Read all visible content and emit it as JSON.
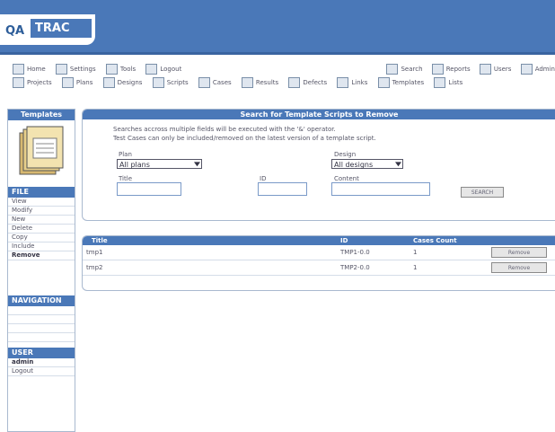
{
  "app": {
    "logo_qa": "QA",
    "logo_trac": "TRAC"
  },
  "toolbar_row1": [
    {
      "label": "Home",
      "icon": "home-icon"
    },
    {
      "label": "Settings",
      "icon": "settings-icon"
    },
    {
      "label": "Tools",
      "icon": "tools-icon"
    },
    {
      "label": "Logout",
      "icon": "logout-icon"
    }
  ],
  "toolbar_row1_right": [
    {
      "label": "Search",
      "icon": "search-icon"
    },
    {
      "label": "Reports",
      "icon": "reports-icon"
    },
    {
      "label": "Users",
      "icon": "users-icon"
    },
    {
      "label": "Admin",
      "icon": "admin-icon"
    }
  ],
  "toolbar_row2": [
    {
      "label": "Projects",
      "icon": "projects-icon"
    },
    {
      "label": "Plans",
      "icon": "plans-icon"
    },
    {
      "label": "Designs",
      "icon": "designs-icon"
    },
    {
      "label": "Scripts",
      "icon": "scripts-icon"
    },
    {
      "label": "Cases",
      "icon": "cases-icon"
    },
    {
      "label": "Results",
      "icon": "results-icon"
    },
    {
      "label": "Defects",
      "icon": "defects-icon"
    },
    {
      "label": "Links",
      "icon": "links-icon"
    },
    {
      "label": "Templates",
      "icon": "templates-icon"
    },
    {
      "label": "Lists",
      "icon": "lists-icon"
    }
  ],
  "sidebar": {
    "title": "Templates",
    "file_head": "FILE",
    "file_items": [
      "View",
      "Modify",
      "New",
      "Delete",
      "Copy",
      "Include",
      "Remove"
    ],
    "nav_head": "NAVIGATION",
    "user_head": "USER",
    "user_items": [
      "admin",
      "Logout"
    ]
  },
  "search": {
    "title": "Search for Template Scripts to Remove",
    "note1": "Searches accross multiple fields will be executed with the '&' operator.",
    "note2": "Test Cases can only be included/removed on the latest version of a template script.",
    "plan_label": "Plan",
    "plan_value": "All plans",
    "design_label": "Design",
    "design_value": "All designs",
    "title_label": "Title",
    "id_label": "ID",
    "content_label": "Content",
    "search_button": "SEARCH"
  },
  "results": {
    "headers": {
      "title": "Title",
      "id": "ID",
      "count": "Cases Count"
    },
    "rows": [
      {
        "title": "tmp1",
        "id": "TMP1-0.0",
        "count": "1",
        "action": "Remove"
      },
      {
        "title": "tmp2",
        "id": "TMP2-0.0",
        "count": "1",
        "action": "Remove"
      }
    ]
  }
}
